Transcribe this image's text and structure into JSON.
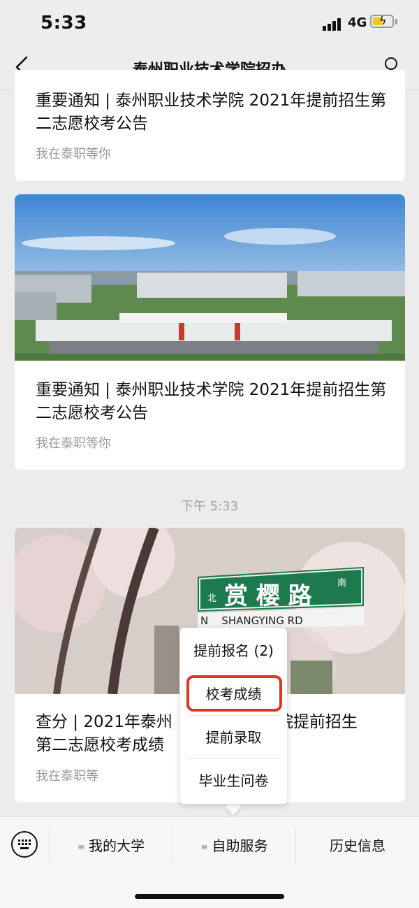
{
  "status_bar": {
    "time": "5:33",
    "network": "4G"
  },
  "nav": {
    "title": "泰州职业技术学院招办",
    "back_icon": "chevron-left-icon",
    "profile_icon": "person-icon"
  },
  "articles": [
    {
      "title": "重要通知 | 泰州职业技术学院 2021年提前招生第二志愿校考公告",
      "source": "我在泰职等你"
    },
    {
      "title": "重要通知 | 泰州职业技术学院 2021年提前招生第二志愿校考公告",
      "source": "我在泰职等你",
      "image": "campus-aerial-photo"
    },
    {
      "title": "查分 | 2021年泰州职业技术学院提前招生第二志愿校考成绩",
      "title_visible_left_1": "查分 | 2021年泰州",
      "title_visible_right_1": "院提前招生",
      "title_visible_left_2": "第二志愿校考成绩",
      "source": "我在泰职等",
      "image": "cherry-blossom-street-photo"
    }
  ],
  "timestamp": "下午 5:33",
  "street_sign": {
    "north": "北",
    "name": "赏 樱 路",
    "south": "南",
    "pinyin": "N    SHANGYING RD"
  },
  "popup_menu": {
    "items": [
      "提前报名 (2)",
      "校考成绩",
      "提前录取",
      "毕业生问卷"
    ],
    "highlighted": "校考成绩",
    "highlight_color": "#e53223"
  },
  "bottom_bar": {
    "keyboard_icon": "keyboard-icon",
    "tabs": [
      "我的大学",
      "自助服务",
      "历史信息"
    ]
  }
}
